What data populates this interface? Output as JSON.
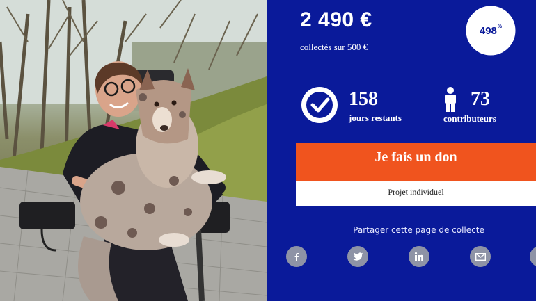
{
  "photo": {
    "subject": "photo-woman-with-dog"
  },
  "campaign": {
    "amount_raised": "2 490 €",
    "collected_text": "collectés sur 500 €",
    "percent": "498",
    "percent_sign": "%",
    "percent_value": 498,
    "days_left": "158",
    "days_left_label": "jours restants",
    "contributors": "73",
    "contributors_label": "contributeurs",
    "donate_label": "Je fais un don",
    "project_type": "Projet individuel"
  },
  "share": {
    "label": "Partager cette page de collecte",
    "networks": [
      {
        "name": "facebook",
        "icon": "facebook-icon"
      },
      {
        "name": "twitter",
        "icon": "twitter-icon"
      },
      {
        "name": "linkedin",
        "icon": "linkedin-icon"
      },
      {
        "name": "email",
        "icon": "email-icon"
      },
      {
        "name": "other",
        "icon": "share-more-icon"
      }
    ]
  },
  "colors": {
    "panel_bg": "#0a1a9a",
    "donate_bg": "#f0541e",
    "share_icon_bg": "#8e93a6"
  }
}
